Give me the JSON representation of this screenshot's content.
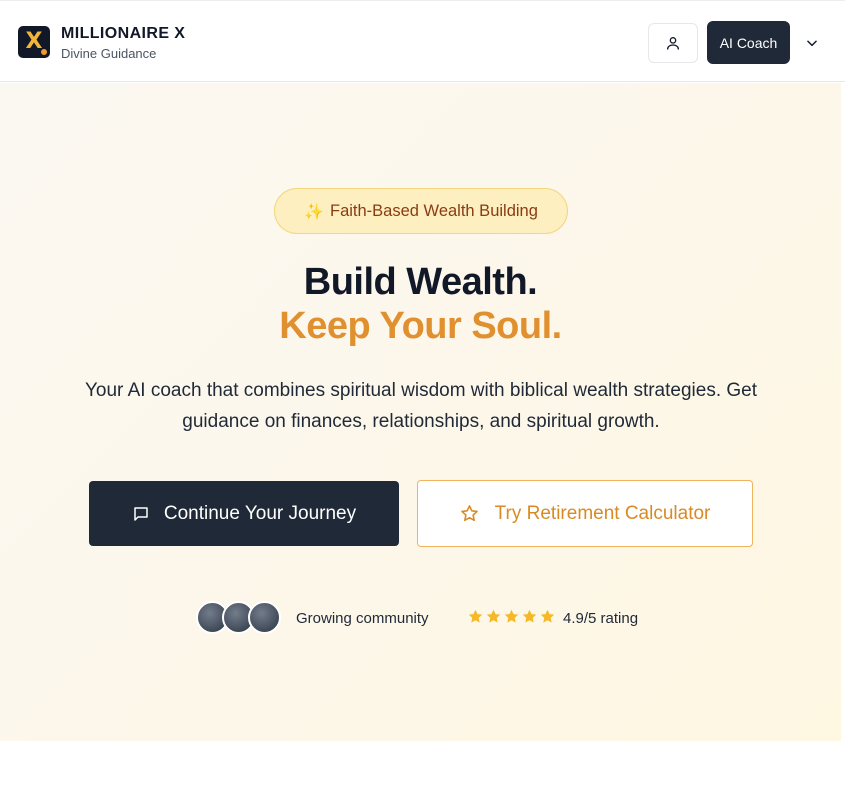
{
  "header": {
    "logo_icon": "x-logo-icon",
    "brand_name": "MILLIONAIRE X",
    "brand_sub": "Divine Guidance",
    "user_icon": "user-icon",
    "coach_label": "AI Coach",
    "chevron_icon": "chevron-down-icon"
  },
  "hero": {
    "badge_icon": "sparkles-icon",
    "badge_label": "Faith-Based Wealth Building",
    "headline_1": "Build Wealth.",
    "headline_2": "Keep Your Soul.",
    "description": "Your AI coach that combines spiritual wisdom with biblical wealth strategies. Get guidance on finances, relationships, and spiritual growth.",
    "primary_icon": "message-square-icon",
    "primary_label": "Continue Your Journey",
    "secondary_icon": "star-outline-icon",
    "secondary_label": "Try Retirement Calculator",
    "community_label": "Growing community",
    "rating_stars": 5,
    "rating_label": "4.9/5 rating"
  },
  "colors": {
    "dark": "#1f2937",
    "accent": "#e0902f",
    "badge_bg": "#fdefc0",
    "star": "#f5b928"
  }
}
